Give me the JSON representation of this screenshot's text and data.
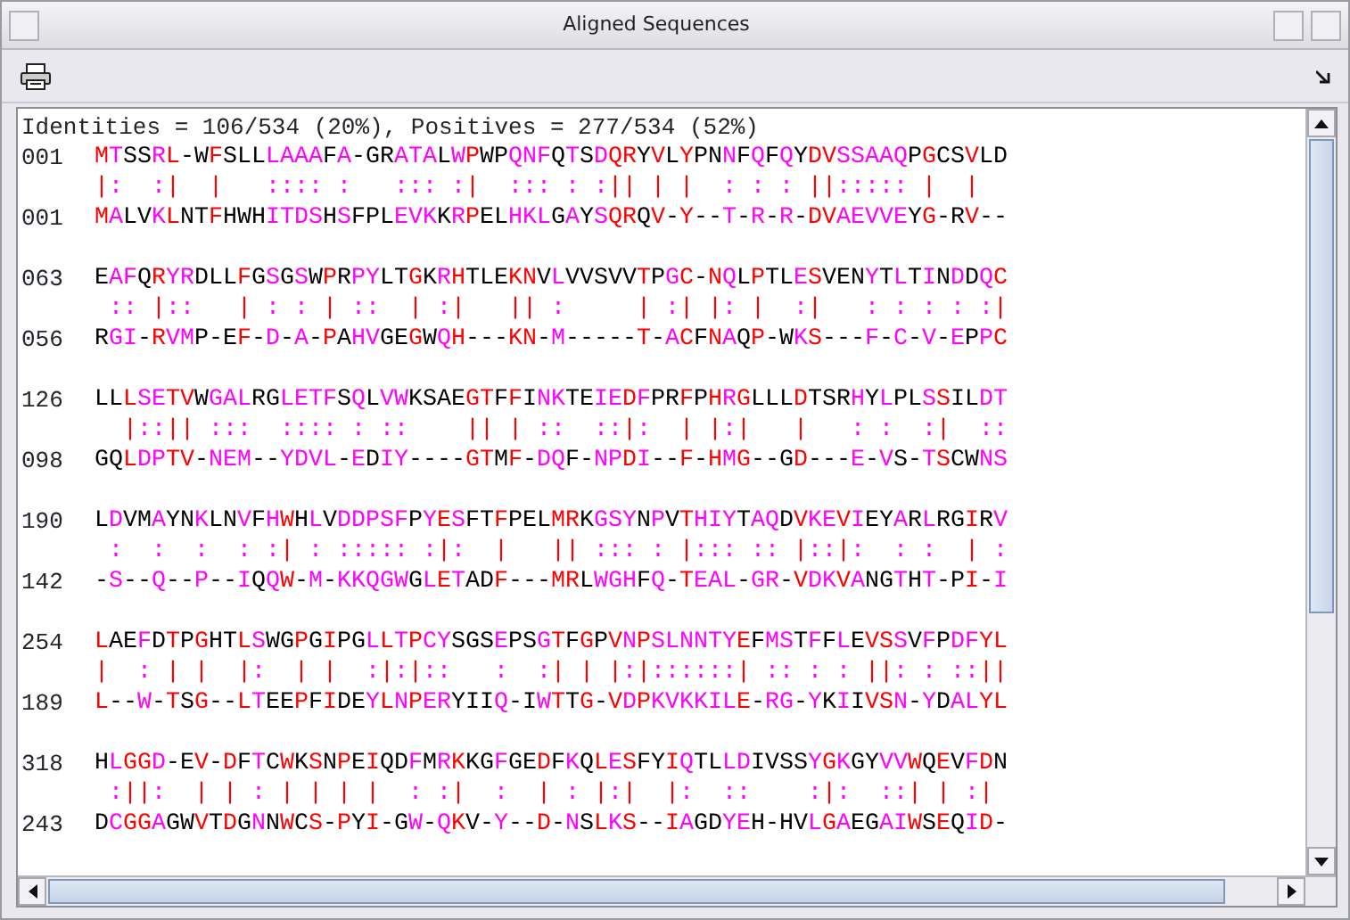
{
  "window": {
    "title": "Aligned Sequences"
  },
  "summary": "Identities = 106/534 (20%), Positives = 277/534 (52%)",
  "blocks": [
    {
      "query_start": "001",
      "query": "MTSSRL-WFSLLLAAAFA-GRATALWPWPQNFQTSDQRYVLYPNNFQFQYDVSSAAQPGCSVLD",
      "match": "|:  :|  |   :::: :   ::: :|  ::: : :|| | |  : : : ||::::: |  |",
      "subject_start": "001",
      "subject": "MALVKLNTFHWHITDSHSFPLEVKKRPELHKLGAYSQRQV-Y--T-R-R-DVAEVVEYG-RV--"
    },
    {
      "query_start": "063",
      "query": "EAFQRYRDLLFGSGSWPRPYLTGKRHTLEKNVLVVSVVTPGC-NQLPTLESVENYTLTINDDQC",
      "match": " :: |::   | : : | ::  | :|   || :     | :| |: |  :|   : : : : :|",
      "subject_start": "056",
      "subject": "RGI-RVMP-EF-D-A-PAHVGEGWQH---KN-M-----T-ACFNAQP-WKS---F-C-V-EPPC"
    },
    {
      "query_start": "126",
      "query": "LLLSETVWGALRGLETFSQLVWKSAEGTFFINKTEIEDFPRFPHRGLLLDTSRHYLPLSSILDT",
      "match": "  |::|| :::  :::: : ::    || | ::  ::|:  | |:|   |   : :  :|  ::",
      "subject_start": "098",
      "subject": "GQLDPTV-NEM--YDVL-EDIY----GTMF-DQF-NPDI--F-HMG--GD---E-VS-TSCWNS"
    },
    {
      "query_start": "190",
      "query": "LDVMAYNKLNVFHWHLVDDPSFPYESFTFPELMRKGSYNPVTHIYTAQDVKEVIEYARLRGIRV",
      "match": " :  :  :  : :| : ::::: :|:  |   || ::: : |::: :: |::|:  : :  | :",
      "subject_start": "142",
      "subject": "-S--Q--P--IQQW-M-KKQGWGLETADF---MRLWGHFQ-TEAL-GR-VDKVANGTHT-PI-I"
    },
    {
      "query_start": "254",
      "query": "LAEFDTPGHTLSWGPGIPGLLTPCYSGSEPSGTFGPVNPSLNNTYEFMSTFFLEVSSVFPDFYL",
      "match": "|  : | |  |:  | |  :|:|::   :  :| | |:|::::::| :: : : ||: : ::||",
      "subject_start": "189",
      "subject": "L--W-TSG--LTEEPFIDEYLNPERYIIQ-IWTTG-VDPKVKKILE-RG-YKIIVSN-YDALYL"
    },
    {
      "query_start": "318",
      "query": "HLGGD-EV-DFTCWKSNPEIQDFMRKKGFGEDFKQLESFYIQTLLDIVSSYGKGYVVWQEVFDN",
      "match": " :||:  | | : | | | |  : :|  :  | : |:|  |:  ::    :|:  ::| | :|",
      "subject_start": "243",
      "subject": "DCGGAGWVTDGNNWCS-PYI-GW-QKV-Y--D-NSLKS--IAGDYEH-HVLGAEGAIWSEQID-"
    }
  ]
}
